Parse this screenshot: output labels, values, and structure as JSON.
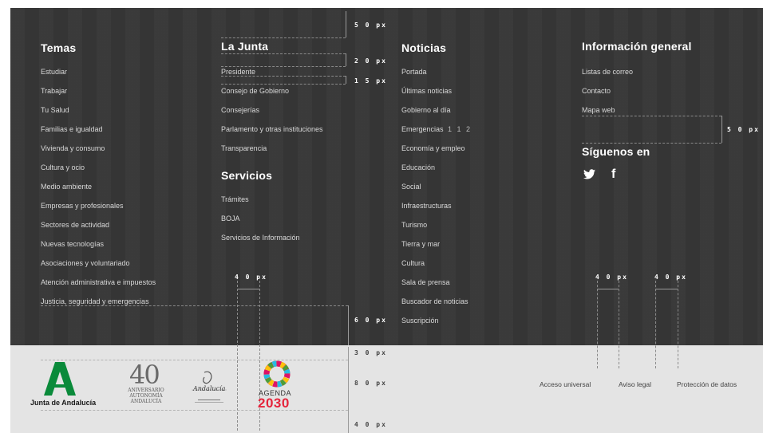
{
  "temas": {
    "title": "Temas",
    "items": [
      "Estudiar",
      "Trabajar",
      "Tu Salud",
      "Familias e igualdad",
      "Vivienda y consumo",
      "Cultura y ocio",
      "Medio ambiente",
      "Empresas y profesionales",
      "Sectores de actividad",
      "Nuevas tecnologías",
      "Asociaciones y voluntariado",
      "Atención administrativa e impuestos",
      "Justicia, seguridad y emergencias"
    ]
  },
  "junta": {
    "title": "La Junta",
    "items": [
      "Presidente",
      "Consejo de Gobierno",
      "Consejerías",
      "Parlamento y otras instituciones",
      "Transparencia"
    ]
  },
  "servicios": {
    "title": "Servicios",
    "items": [
      "Trámites",
      "BOJA",
      "Servicios de Información"
    ]
  },
  "noticias": {
    "title": "Noticias",
    "items": [
      "Portada",
      "Últimas noticias",
      "Gobierno al día",
      "Emergencias",
      "Economía y empleo",
      "Educación",
      "Social",
      "Infraestructuras",
      "Turismo",
      "Tierra y mar",
      "Cultura",
      "Sala de prensa",
      "Buscador de noticias",
      "Suscripción"
    ],
    "emergency_number": "1 1 2"
  },
  "info": {
    "title": "Información general",
    "items": [
      "Listas de correo",
      "Contacto",
      "Mapa web"
    ]
  },
  "siguenos": {
    "title": "Síguenos en",
    "icons": [
      "twitter-icon",
      "facebook-icon"
    ],
    "twitter_glyph": "🐦",
    "facebook_glyph": "f"
  },
  "measures": {
    "m50_top": "5 0 px",
    "m20": "2 0 px",
    "m15": "1 5 px",
    "m50_right": "5 0 px",
    "m40_mid": "4 0 px",
    "m40_a": "4 0 px",
    "m40_b": "4 0 px",
    "m60": "6 0 px",
    "m30": "3 0 px",
    "m80": "8 0 px",
    "m40_bottom": "4 0 px"
  },
  "footer": {
    "brand": "Junta de Andalucía",
    "anniv_number": "40",
    "anniv_lines": [
      "ANIVERSARIO",
      "AUTONOMÍA",
      "ANDALUCÍA"
    ],
    "andalucia_script": "Andalucía",
    "agenda_label": "AGENDA",
    "agenda_year": "2030",
    "links": [
      "Acceso universal",
      "Aviso legal",
      "Protección de datos"
    ]
  },
  "colors": {
    "dark_bg": "#353535",
    "light_bg": "#e4e4e4",
    "junta_green": "#0a8a3a",
    "agenda_red": "#e5243b"
  }
}
